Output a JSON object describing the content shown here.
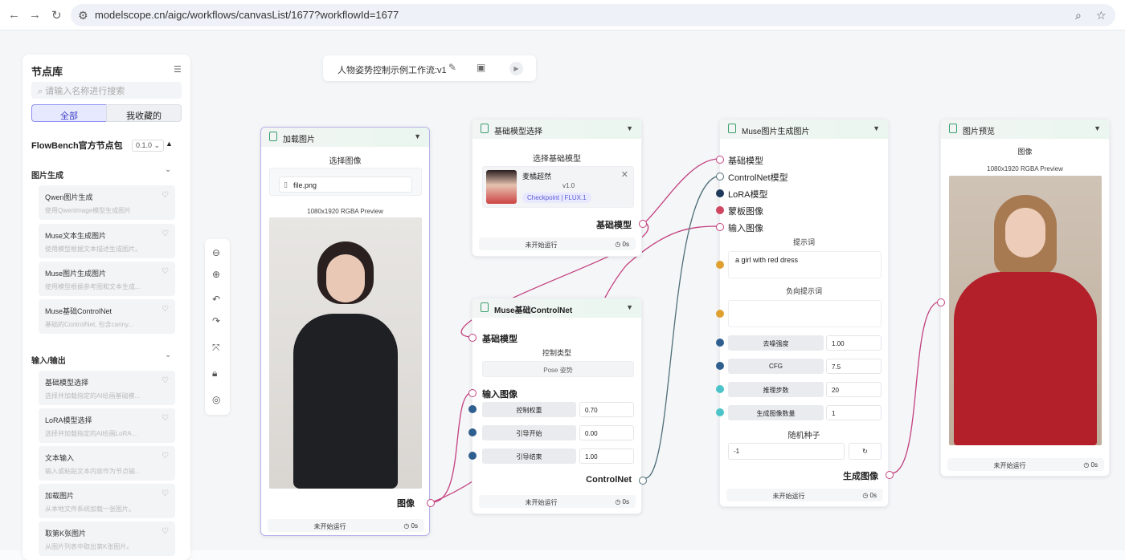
{
  "browser": {
    "url": "modelscope.cn/aigc/workflows/canvasList/1677?workflowId=1677"
  },
  "sidebar": {
    "title": "节点库",
    "search_placeholder": "请输入名称进行搜索",
    "tabs": [
      "全部",
      "我收藏的"
    ],
    "package": "FlowBench官方节点包",
    "version": "0.1.0",
    "cat1": "图片生成",
    "cat2": "输入/输出",
    "items": [
      {
        "name": "Qwen图片生成",
        "desc": "使用QwenImage模型生成图片"
      },
      {
        "name": "Muse文本生成图片",
        "desc": "使用模型根据文本描述生成图片。"
      },
      {
        "name": "Muse图片生成图片",
        "desc": "使用模型根据参考图和文本生成..."
      },
      {
        "name": "Muse基础ControlNet",
        "desc": "基础的ControlNet, 包含canny..."
      },
      {
        "name": "基础模型选择",
        "desc": "选择并加载指定的AI绘画基础模..."
      },
      {
        "name": "LoRA模型选择",
        "desc": "选择并加载指定的AI绘画LoRA..."
      },
      {
        "name": "文本输入",
        "desc": "输入或粘贴文本内容作为节点输..."
      },
      {
        "name": "加载图片",
        "desc": "从本地文件系统加载一张图片。"
      },
      {
        "name": "取第K张图片",
        "desc": "从图片列表中取出第K张图片。"
      }
    ]
  },
  "workflow": {
    "title": "人物姿势控制示例工作流:v1"
  },
  "status_text": "未开始运行",
  "time_text": "0s",
  "nodes": {
    "load": {
      "title": "加载图片",
      "section": "选择图像",
      "file": "file.png",
      "preview": "1080x1920 RGBA Preview",
      "out": "图像"
    },
    "base": {
      "title": "基础模型选择",
      "section": "选择基础模型",
      "model": "麦橘超然",
      "model_ver": "v1.0",
      "tag": "Checkpoint | FLUX.1",
      "out": "基础模型"
    },
    "cn": {
      "title": "Muse基础ControlNet",
      "in1": "基础模型",
      "ctl_type_label": "控制类型",
      "ctl_type": "Pose 姿势",
      "in2": "输入图像",
      "params": [
        {
          "name": "控制权重",
          "value": "0.70"
        },
        {
          "name": "引导开始",
          "value": "0.00"
        },
        {
          "name": "引导结束",
          "value": "1.00"
        }
      ],
      "out": "ControlNet"
    },
    "gen": {
      "title": "Muse图片生成图片",
      "inputs": [
        "基础模型",
        "ControlNet模型",
        "LoRA模型",
        "蒙板图像",
        "输入图像"
      ],
      "prompt_label": "提示词",
      "prompt": "a girl with red dress",
      "neg_label": "负向提示词",
      "params": [
        {
          "name": "去噪强度",
          "value": "1.00"
        },
        {
          "name": "CFG",
          "value": "7.5"
        },
        {
          "name": "推理步数",
          "value": "20"
        },
        {
          "name": "生成图像数量",
          "value": "1"
        }
      ],
      "seed_label": "随机种子",
      "seed": "-1",
      "out": "生成图像"
    },
    "prev": {
      "title": "图片预览",
      "section": "图像",
      "preview": "1080x1920 RGBA Preview"
    }
  },
  "colors": {
    "accent": "#5b5bd6",
    "port": "#c2407f",
    "dot_blue": "#2f5f8f",
    "dot_orange": "#e0a030",
    "dot_teal": "#4cc3c8",
    "dot_red": "#d0455f",
    "dot_navy": "#1e3a5a"
  }
}
